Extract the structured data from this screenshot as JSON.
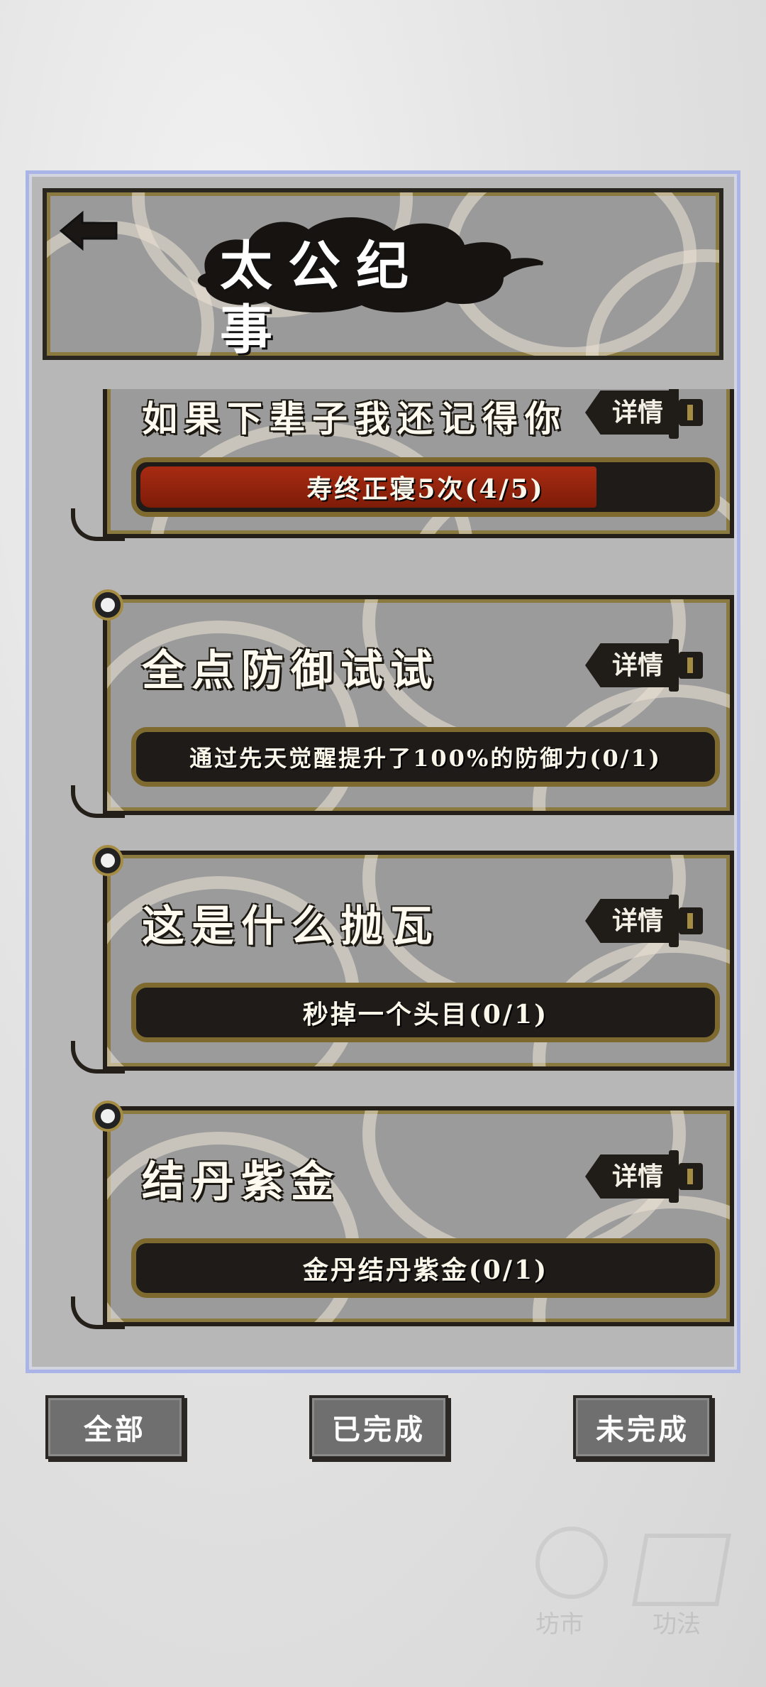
{
  "header": {
    "title": "太公纪事"
  },
  "achievements": [
    {
      "title": "如果下辈子我还记得你",
      "detail_label": "详情",
      "progress_text": "寿终正寝5次(4/5)",
      "progress": 0.8
    },
    {
      "title": "全点防御试试",
      "detail_label": "详情",
      "progress_text": "通过先天觉醒提升了100%的防御力(0/1)",
      "progress": 0
    },
    {
      "title": "这是什么抛瓦",
      "detail_label": "详情",
      "progress_text": "秒掉一个头目(0/1)",
      "progress": 0
    },
    {
      "title": "结丹紫金",
      "detail_label": "详情",
      "progress_text": "金丹结丹紫金(0/1)",
      "progress": 0
    }
  ],
  "tabs": [
    {
      "label": "全部"
    },
    {
      "label": "已完成"
    },
    {
      "label": "未完成"
    }
  ],
  "background": {
    "labels": [
      "坊市",
      "功法"
    ]
  },
  "colors": {
    "progress_fill": "#a82b12",
    "frame_gold": "#8a7a3f",
    "panel_border": "#aab4e6"
  },
  "icons": {
    "back": "back-arrow-icon",
    "detail": "sword-icon",
    "pin": "pin-icon"
  }
}
